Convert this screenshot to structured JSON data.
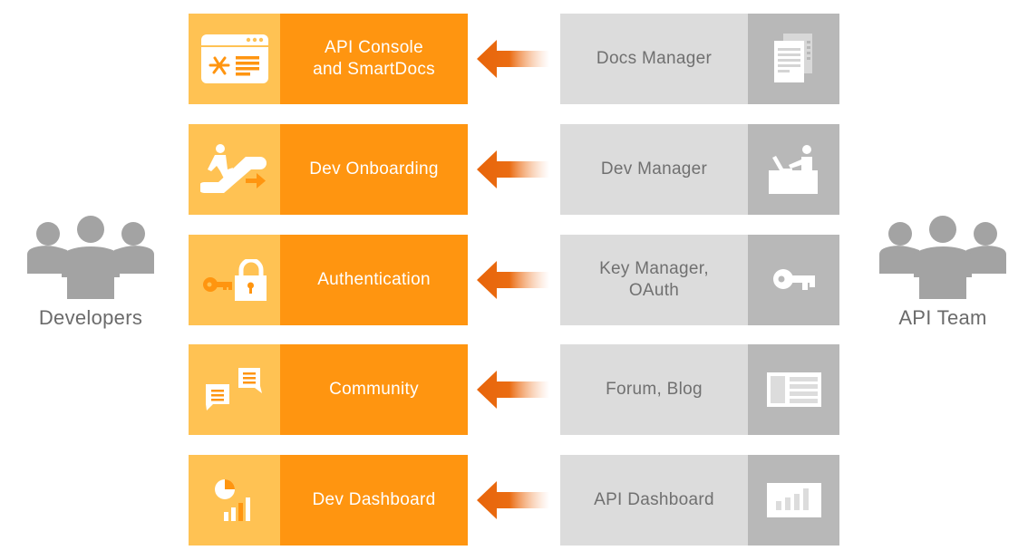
{
  "diagram": {
    "left_group": {
      "label": "Developers",
      "icon": "people-group-icon"
    },
    "right_group": {
      "label": "API Team",
      "icon": "people-group-icon"
    },
    "colors": {
      "dev_box": "#ff9510",
      "dev_icon_box": "#ffc253",
      "team_box": "#dcdcdc",
      "team_icon_box": "#b8b8b8",
      "arrow": "#e8650a",
      "people_icon": "#a3a3a3",
      "label_text": "#6b6b6b"
    },
    "rows": [
      {
        "developer_feature": "API Console\nand SmartDocs",
        "developer_icon": "browser-console-icon",
        "team_tool": "Docs Manager",
        "team_icon": "documents-icon",
        "flow": "team-to-developer"
      },
      {
        "developer_feature": "Dev Onboarding",
        "developer_icon": "escalator-icon",
        "team_tool": "Dev Manager",
        "team_icon": "person-at-desk-icon",
        "flow": "team-to-developer"
      },
      {
        "developer_feature": "Authentication",
        "developer_icon": "key-lock-icon",
        "team_tool": "Key Manager,\nOAuth",
        "team_icon": "key-icon",
        "flow": "team-to-developer"
      },
      {
        "developer_feature": "Community",
        "developer_icon": "chat-bubbles-icon",
        "team_tool": "Forum, Blog",
        "team_icon": "article-layout-icon",
        "flow": "team-to-developer"
      },
      {
        "developer_feature": "Dev Dashboard",
        "developer_icon": "pie-bar-chart-icon",
        "team_tool": "API Dashboard",
        "team_icon": "bar-chart-icon",
        "flow": "team-to-developer"
      }
    ]
  }
}
